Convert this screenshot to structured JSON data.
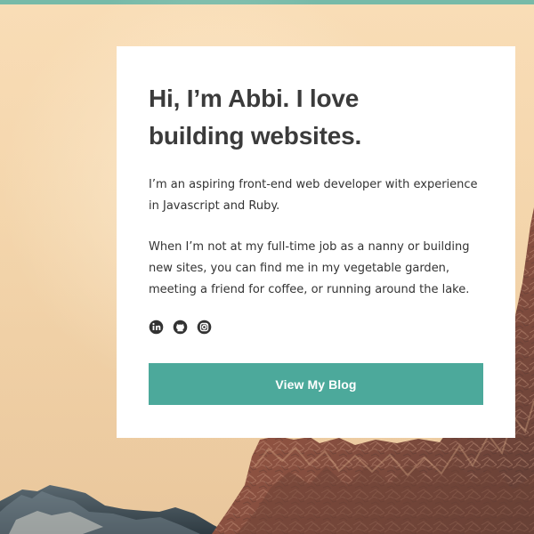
{
  "hero": {
    "headline": "Hi, I’m Abbi. I love building websites.",
    "intro": "I’m an aspiring front-end web developer with experience in Javascript and Ruby.",
    "bio": "When I’m not at my full-time job as a nanny or building new sites, you can find me in my vegetable garden, meeting a friend for coffee, or running around the lake.",
    "social_icons": [
      "linkedin-icon",
      "github-icon",
      "instagram-icon"
    ],
    "button_label": "View My Blog"
  },
  "colors": {
    "accent": "#4ca99b",
    "text": "#333333",
    "card": "#ffffff",
    "background": "#f6d7ac"
  }
}
